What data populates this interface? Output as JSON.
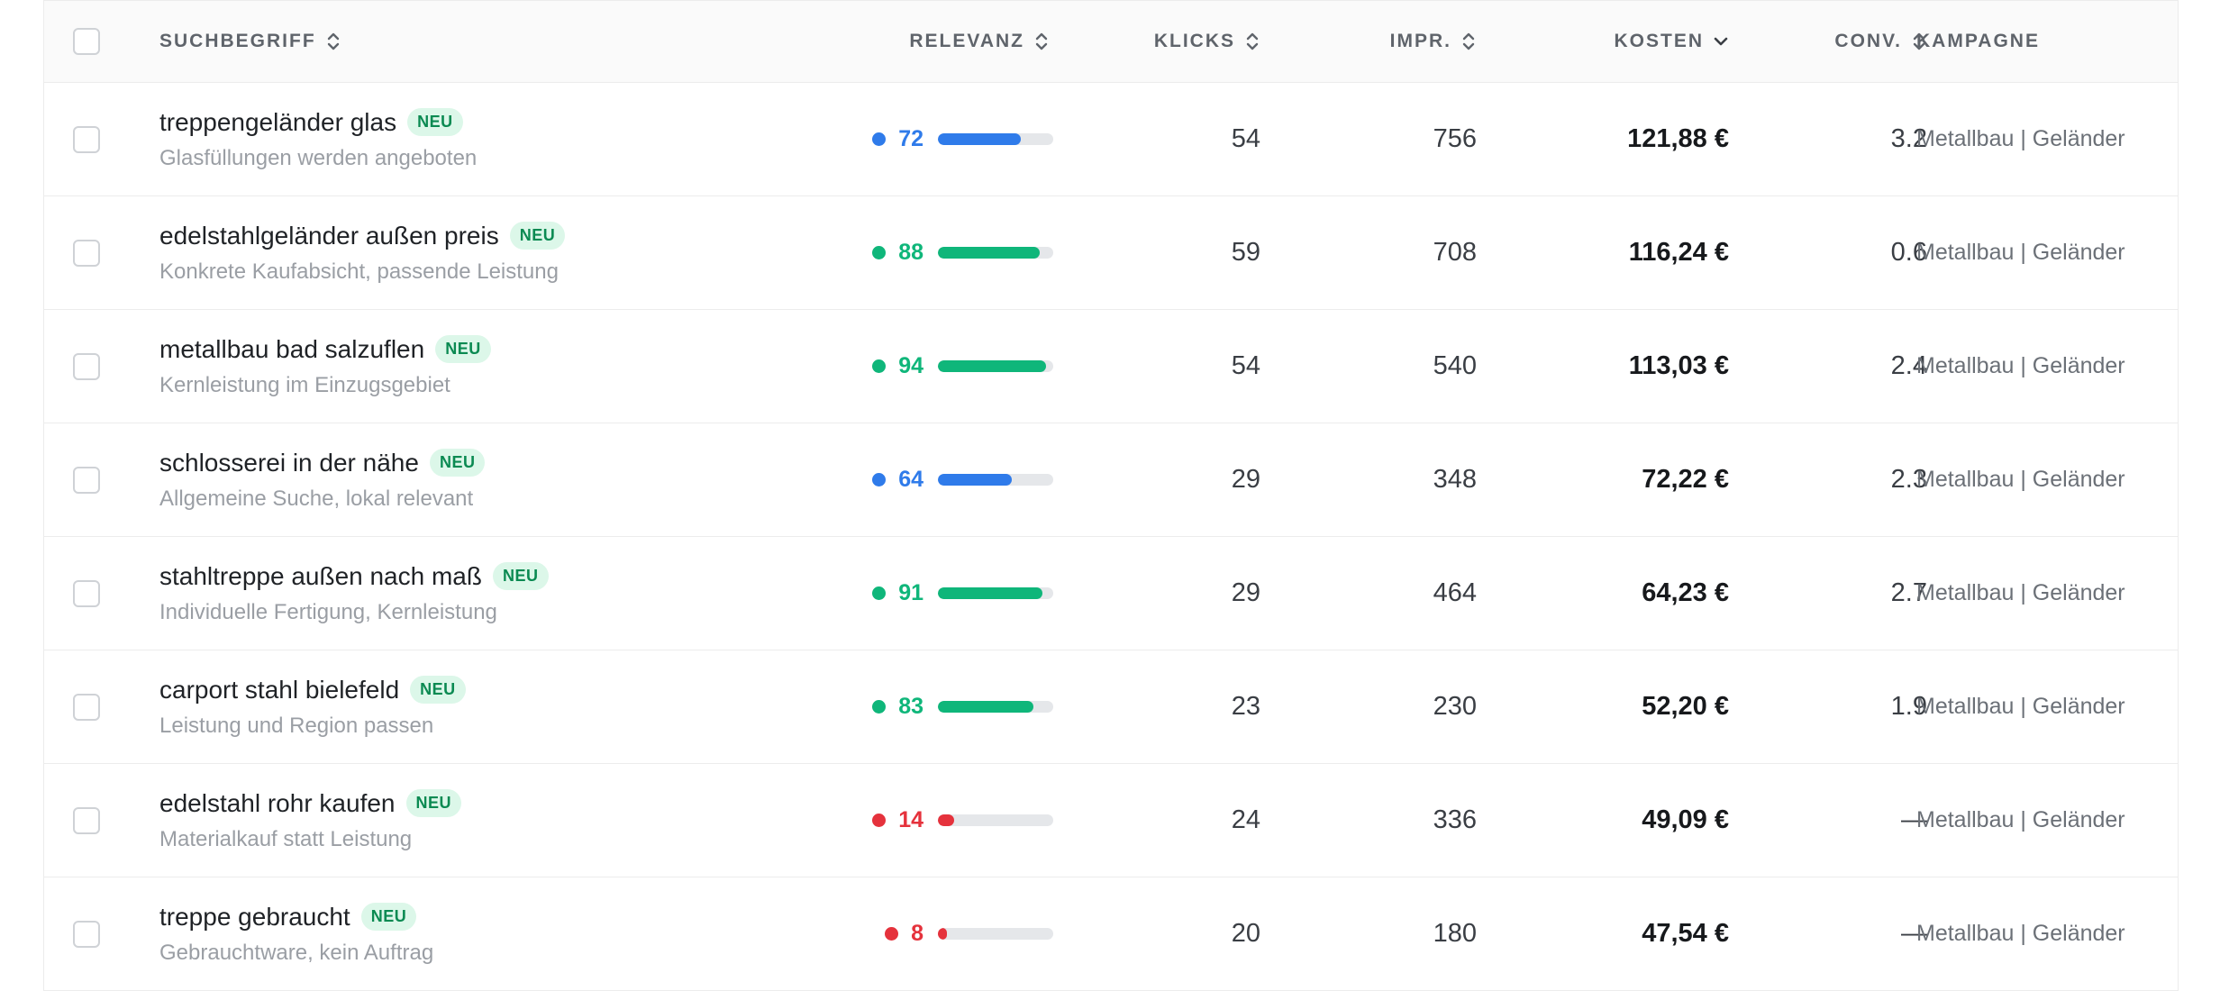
{
  "header": {
    "term": "SUCHBEGRIFF",
    "relevance": "RELEVANZ",
    "clicks": "KLICKS",
    "impressions": "IMPR.",
    "cost": "KOSTEN",
    "conversions": "CONV.",
    "campaign": "KAMPAGNE"
  },
  "colors": {
    "high": "#0fb67a",
    "medium": "#2f7bea",
    "low": "#e5323c",
    "badge_bg": "#dcf7e9",
    "badge_text": "#0b8a52"
  },
  "rows": [
    {
      "term": "treppengeländer glas",
      "badge": "NEU",
      "note": "Glasfüllungen werden angeboten",
      "relevance": 72,
      "level": "medium",
      "clicks": "54",
      "impressions": "756",
      "cost": "121,88 €",
      "conv": "3.2",
      "campaign": "Metallbau | Geländer"
    },
    {
      "term": "edelstahlgeländer außen preis",
      "badge": "NEU",
      "note": "Konkrete Kaufabsicht, passende Leistung",
      "relevance": 88,
      "level": "high",
      "clicks": "59",
      "impressions": "708",
      "cost": "116,24 €",
      "conv": "0.6",
      "campaign": "Metallbau | Geländer"
    },
    {
      "term": "metallbau bad salzuflen",
      "badge": "NEU",
      "note": "Kernleistung im Einzugsgebiet",
      "relevance": 94,
      "level": "high",
      "clicks": "54",
      "impressions": "540",
      "cost": "113,03 €",
      "conv": "2.4",
      "campaign": "Metallbau | Geländer"
    },
    {
      "term": "schlosserei in der nähe",
      "badge": "NEU",
      "note": "Allgemeine Suche, lokal relevant",
      "relevance": 64,
      "level": "medium",
      "clicks": "29",
      "impressions": "348",
      "cost": "72,22 €",
      "conv": "2.3",
      "campaign": "Metallbau | Geländer"
    },
    {
      "term": "stahltreppe außen nach maß",
      "badge": "NEU",
      "note": "Individuelle Fertigung, Kernleistung",
      "relevance": 91,
      "level": "high",
      "clicks": "29",
      "impressions": "464",
      "cost": "64,23 €",
      "conv": "2.7",
      "campaign": "Metallbau | Geländer"
    },
    {
      "term": "carport stahl bielefeld",
      "badge": "NEU",
      "note": "Leistung und Region passen",
      "relevance": 83,
      "level": "high",
      "clicks": "23",
      "impressions": "230",
      "cost": "52,20 €",
      "conv": "1.9",
      "campaign": "Metallbau | Geländer"
    },
    {
      "term": "edelstahl rohr kaufen",
      "badge": "NEU",
      "note": "Materialkauf statt Leistung",
      "relevance": 14,
      "level": "low",
      "clicks": "24",
      "impressions": "336",
      "cost": "49,09 €",
      "conv": "—",
      "campaign": "Metallbau | Geländer"
    },
    {
      "term": "treppe gebraucht",
      "badge": "NEU",
      "note": "Gebrauchtware, kein Auftrag",
      "relevance": 8,
      "level": "low",
      "clicks": "20",
      "impressions": "180",
      "cost": "47,54 €",
      "conv": "—",
      "campaign": "Metallbau | Geländer"
    }
  ]
}
